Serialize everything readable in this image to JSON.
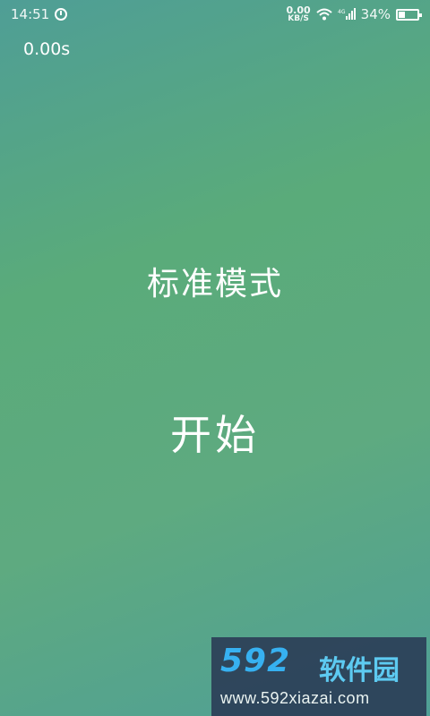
{
  "status_bar": {
    "time": "14:51",
    "net_speed_value": "0.00",
    "net_speed_unit": "KB/S",
    "network_type": "4G",
    "battery_percent": "34%",
    "battery_level": 0.34
  },
  "timer": {
    "elapsed": "0.00s"
  },
  "main": {
    "mode_label": "标准模式",
    "start_label": "开始"
  },
  "watermark": {
    "logo_number": "592",
    "logo_text": "软件园",
    "url": "www.592xiazai.com"
  }
}
